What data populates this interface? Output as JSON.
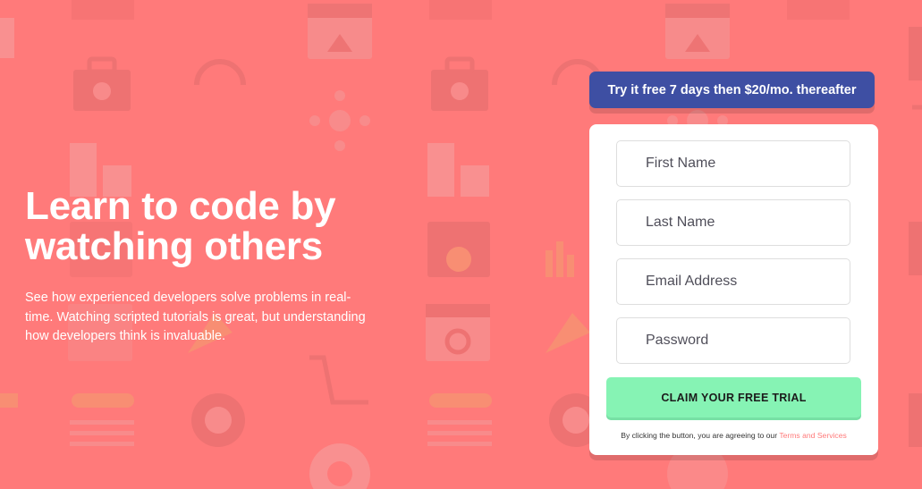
{
  "hero": {
    "title_line1": "Learn to code by",
    "title_line2": "watching others",
    "description": "See how experienced developers solve problems in real-time. Watching scripted tutorials is great, but understanding how developers think is invaluable."
  },
  "promo": {
    "text": "Try it free 7 days then $20/mo. thereafter"
  },
  "form": {
    "first_name_placeholder": "First Name",
    "last_name_placeholder": "Last Name",
    "email_placeholder": "Email Address",
    "password_placeholder": "Password",
    "submit_label": "CLAIM YOUR FREE TRIAL",
    "terms_prefix": "By clicking the button, you are agreeing to our",
    "terms_link": "Terms and Services"
  },
  "colors": {
    "background": "#ff7a7a",
    "promo_bg": "#3e4fa3",
    "cta_bg": "#86f3b4",
    "link": "#ff7a7a"
  },
  "icons": [
    "home-window-icon",
    "toolbox-icon",
    "headset-icon",
    "network-icon",
    "puzzle-icon",
    "settings-icon",
    "search-window-icon",
    "rocket-icon",
    "gear-icon",
    "lifebuoy-icon",
    "document-icon",
    "chart-icon"
  ]
}
